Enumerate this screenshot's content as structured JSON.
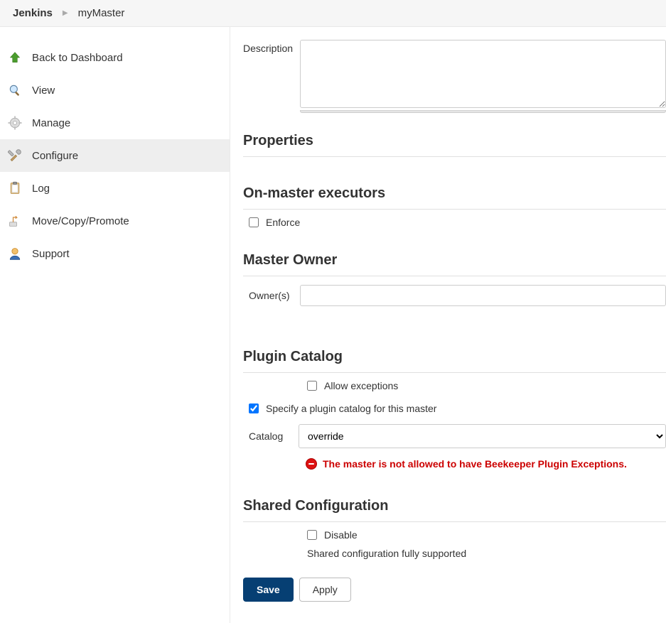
{
  "breadcrumb": {
    "root": "Jenkins",
    "item": "myMaster"
  },
  "sidebar": {
    "items": [
      {
        "label": "Back to Dashboard"
      },
      {
        "label": "View"
      },
      {
        "label": "Manage"
      },
      {
        "label": "Configure"
      },
      {
        "label": "Log"
      },
      {
        "label": "Move/Copy/Promote"
      },
      {
        "label": "Support"
      }
    ]
  },
  "form": {
    "description_label": "Description",
    "description_value": "",
    "properties_heading": "Properties",
    "executors_heading": "On-master executors",
    "enforce_label": "Enforce",
    "owner_heading": "Master Owner",
    "owner_label": "Owner(s)",
    "owner_value": "",
    "catalog_heading": "Plugin Catalog",
    "allow_exceptions_label": "Allow exceptions",
    "specify_catalog_label": "Specify a plugin catalog for this master",
    "catalog_label": "Catalog",
    "catalog_value": "override",
    "error_message": "The master is not allowed to have Beekeeper Plugin Exceptions.",
    "shared_heading": "Shared Configuration",
    "disable_label": "Disable",
    "shared_help": "Shared configuration fully supported",
    "save_label": "Save",
    "apply_label": "Apply"
  }
}
